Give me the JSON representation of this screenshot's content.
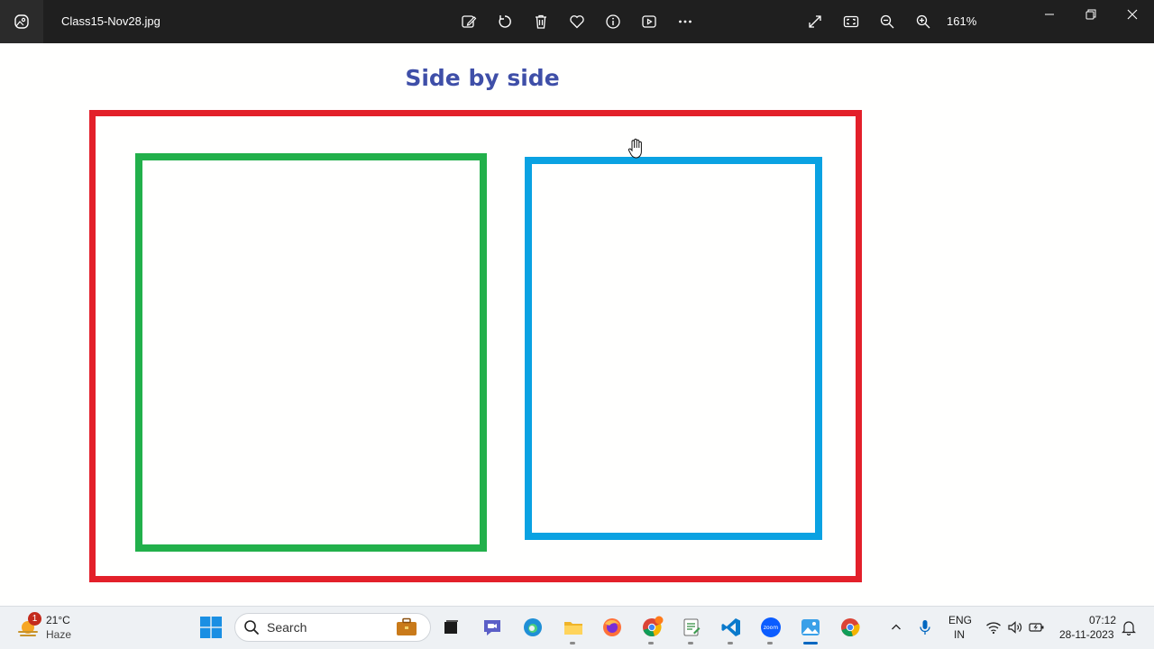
{
  "window": {
    "file_name": "Class15-Nov28.jpg",
    "zoom_level": "161%"
  },
  "toolbar": {
    "icons": [
      "edit-image-icon",
      "rotate-icon",
      "delete-icon",
      "favorite-icon",
      "info-icon",
      "slideshow-icon",
      "more-icon"
    ],
    "view_icons": [
      "fullscreen-icon",
      "fit-to-window-icon",
      "zoom-out-icon",
      "zoom-in-icon"
    ]
  },
  "image": {
    "title": "Side by side",
    "colors": {
      "title": "#3f4fa8",
      "outer_border": "#e3202a",
      "left_border": "#22b04b",
      "right_border": "#0aa2e2"
    }
  },
  "taskbar": {
    "weather": {
      "badge": "1",
      "temperature": "21°C",
      "condition": "Haze"
    },
    "search_placeholder": "Search",
    "apps": [
      "task-view",
      "meet",
      "edge",
      "file-explorer",
      "firefox",
      "chrome-profile",
      "notepad",
      "vscode",
      "zoom",
      "photos",
      "chrome"
    ],
    "language": {
      "line1": "ENG",
      "line2": "IN"
    },
    "clock": {
      "time": "07:12",
      "date": "28-11-2023"
    }
  }
}
